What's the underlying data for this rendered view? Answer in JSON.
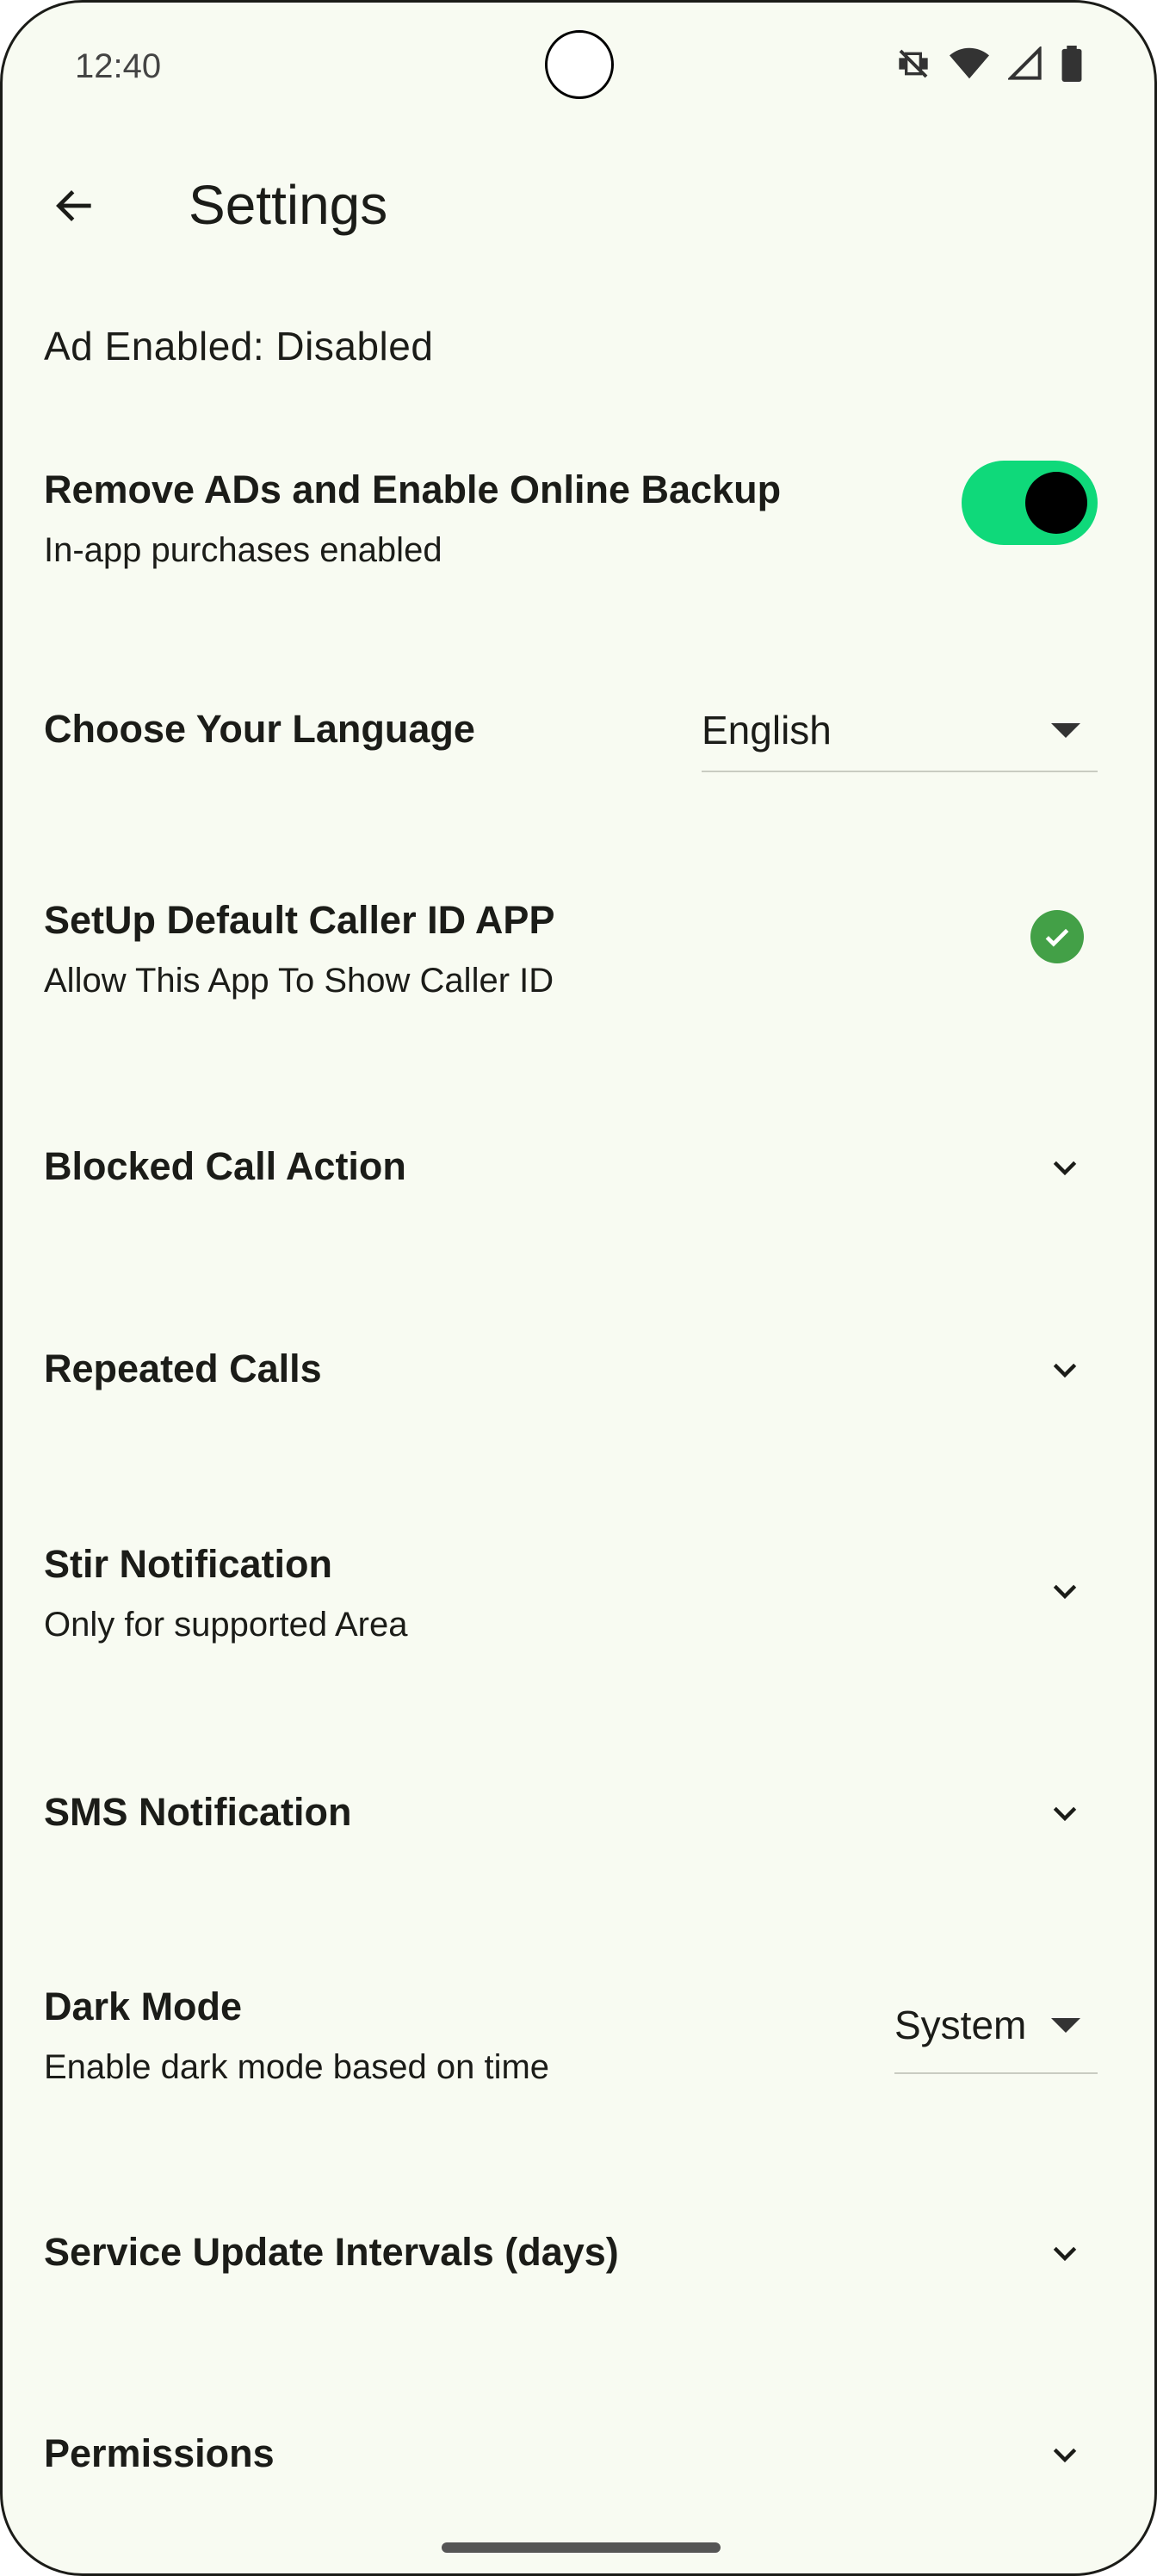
{
  "status_bar": {
    "time": "12:40",
    "icons": [
      "vibrate-off-icon",
      "wifi-icon",
      "cellular-signal-icon",
      "battery-icon"
    ]
  },
  "app_bar": {
    "title": "Settings",
    "back_icon": "arrow-back-icon"
  },
  "ads_status": "Ad Enabled: Disabled",
  "settings": {
    "remove_ads": {
      "title": "Remove ADs and Enable Online Backup",
      "subtitle": "In-app purchases enabled",
      "toggle_on": true
    },
    "language": {
      "title": "Choose Your Language",
      "value": "English"
    },
    "caller_id": {
      "title": "SetUp Default Caller ID APP",
      "subtitle": "Allow This App To Show Caller ID",
      "status_icon": "check-circle-icon"
    },
    "blocked_call_action": {
      "title": "Blocked Call Action"
    },
    "repeated_calls": {
      "title": "Repeated Calls"
    },
    "stir_notification": {
      "title": "Stir Notification",
      "subtitle": "Only for supported Area"
    },
    "sms_notification": {
      "title": "SMS Notification"
    },
    "dark_mode": {
      "title": "Dark Mode",
      "subtitle": "Enable dark mode based on time",
      "value": "System"
    },
    "service_update_intervals": {
      "title": "Service Update Intervals (days)"
    },
    "permissions": {
      "title": "Permissions"
    }
  },
  "colors": {
    "background": "#f8fbf2",
    "toggle_track": "#0fd97a",
    "check": "#43a047"
  }
}
